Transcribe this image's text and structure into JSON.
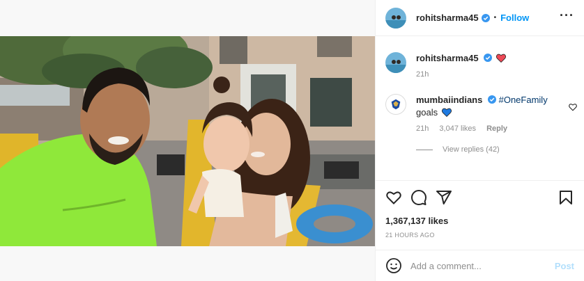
{
  "post": {
    "author": "rohitsharma45",
    "verified": true,
    "follow_label": "Follow",
    "more_icon": "more-horizontal-icon"
  },
  "caption": {
    "author": "rohitsharma45",
    "emoji": "red-heart",
    "time": "21h"
  },
  "comments": [
    {
      "author": "mumbaiindians",
      "hashtag": "#OneFamily",
      "text": "goals",
      "emoji": "blue-heart",
      "time": "21h",
      "likes": "3,047 likes",
      "reply_label": "Reply",
      "view_replies": "View replies (42)"
    }
  ],
  "stats": {
    "likes": "1,367,137 likes",
    "posted": "21 HOURS AGO"
  },
  "composer": {
    "placeholder": "Add a comment...",
    "post_label": "Post"
  },
  "colors": {
    "accent": "#0095f6",
    "post_disabled": "#b2dffc",
    "verified": "#3897f0",
    "red_heart": "#ed4956",
    "blue_heart": "#1f7ae0"
  }
}
